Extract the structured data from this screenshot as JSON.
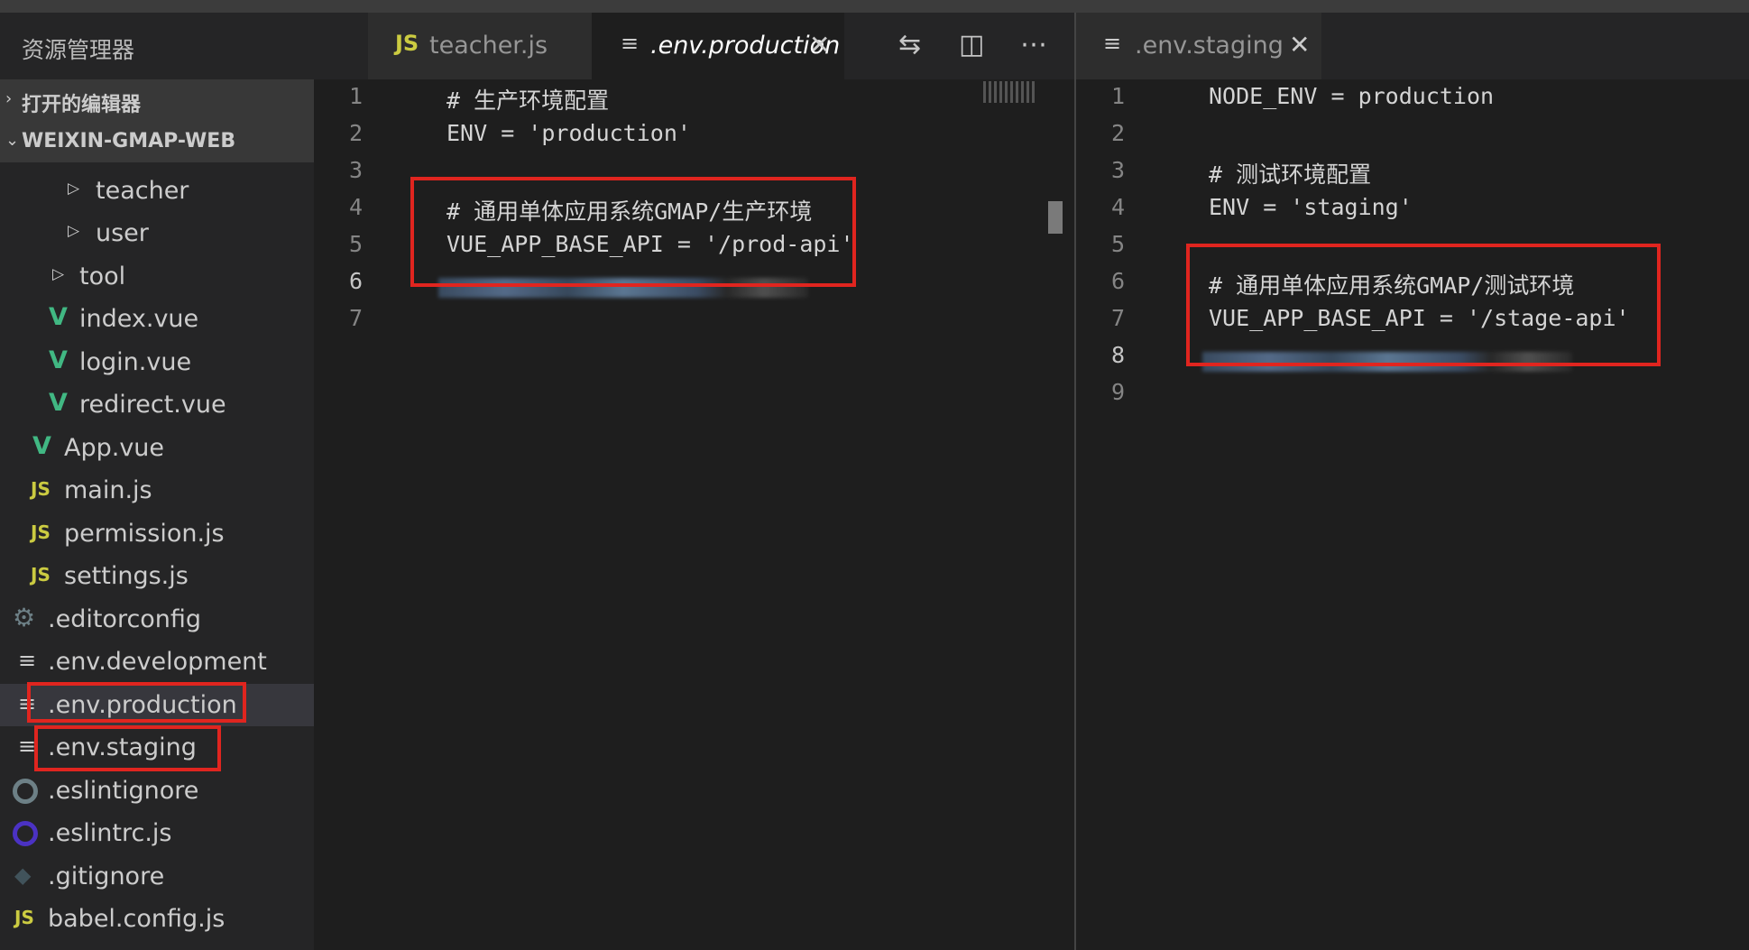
{
  "explorer": {
    "title": "资源管理器",
    "open_editors_label": "打开的编辑器",
    "project_label": "WEIXIN-GMAP-WEB",
    "tree": [
      {
        "name": "teacher",
        "type": "folder"
      },
      {
        "name": "user",
        "type": "folder"
      },
      {
        "name": "tool",
        "type": "folder"
      },
      {
        "name": "index.vue",
        "type": "vue"
      },
      {
        "name": "login.vue",
        "type": "vue"
      },
      {
        "name": "redirect.vue",
        "type": "vue"
      },
      {
        "name": "App.vue",
        "type": "vue"
      },
      {
        "name": "main.js",
        "type": "js"
      },
      {
        "name": "permission.js",
        "type": "js"
      },
      {
        "name": "settings.js",
        "type": "js"
      },
      {
        "name": ".editorconfig",
        "type": "config"
      },
      {
        "name": ".env.development",
        "type": "env"
      },
      {
        "name": ".env.production",
        "type": "env",
        "selected": true
      },
      {
        "name": ".env.staging",
        "type": "env"
      },
      {
        "name": ".eslintignore",
        "type": "eslint-ignore"
      },
      {
        "name": ".eslintrc.js",
        "type": "eslint"
      },
      {
        "name": ".gitignore",
        "type": "git"
      },
      {
        "name": "babel.config.js",
        "type": "js"
      }
    ]
  },
  "icons": {
    "js_text": "JS",
    "vue_text": "V"
  },
  "left_group": {
    "tabs": [
      {
        "label": "teacher.js",
        "icon": "js",
        "active": false
      },
      {
        "label": ".env.production",
        "icon": "lines",
        "active": true,
        "close": "✕"
      }
    ],
    "actions": [
      "compare-changes-icon",
      "split-editor-icon",
      "more-actions-icon"
    ],
    "lines": [
      {
        "n": "1",
        "text": "# 生产环境配置"
      },
      {
        "n": "2",
        "text": "ENV = 'production'"
      },
      {
        "n": "3",
        "text": ""
      },
      {
        "n": "4",
        "text": "# 通用单体应用系统GMAP/生产环境"
      },
      {
        "n": "5",
        "text": "VUE_APP_BASE_API = '/prod-api'"
      },
      {
        "n": "6",
        "text": "",
        "current": true
      },
      {
        "n": "7",
        "text": ""
      }
    ]
  },
  "right_group": {
    "tabs": [
      {
        "label": ".env.staging",
        "icon": "lines",
        "active": true,
        "close": "✕"
      }
    ],
    "lines": [
      {
        "n": "1",
        "text": "NODE_ENV = production"
      },
      {
        "n": "2",
        "text": ""
      },
      {
        "n": "3",
        "text": "# 测试环境配置"
      },
      {
        "n": "4",
        "text": "ENV = 'staging'"
      },
      {
        "n": "5",
        "text": ""
      },
      {
        "n": "6",
        "text": "# 通用单体应用系统GMAP/测试环境"
      },
      {
        "n": "7",
        "text": "VUE_APP_BASE_API = '/stage-api'"
      },
      {
        "n": "8",
        "text": "",
        "current": true
      },
      {
        "n": "9",
        "text": ""
      }
    ]
  },
  "colors": {
    "highlight_box": "#e0251f",
    "vue_green": "#41b883",
    "js_yellow": "#cbcb41"
  }
}
